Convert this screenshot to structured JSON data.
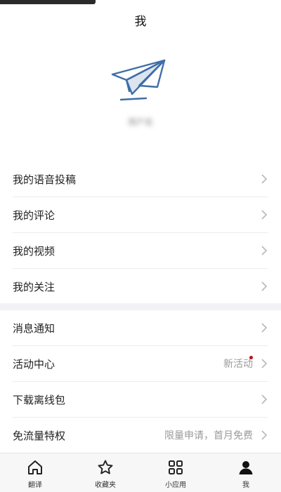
{
  "header": {
    "title": "我"
  },
  "profile": {
    "username": "用户名"
  },
  "menu_group_1": [
    {
      "label": "我的语音投稿"
    },
    {
      "label": "我的评论"
    },
    {
      "label": "我的视频"
    },
    {
      "label": "我的关注"
    }
  ],
  "menu_group_2": [
    {
      "label": "消息通知",
      "extra": ""
    },
    {
      "label": "活动中心",
      "extra": "新活动"
    },
    {
      "label": "下载离线包",
      "extra": ""
    },
    {
      "label": "免流量特权",
      "extra": "限量申请，首月免费"
    }
  ],
  "tabbar": [
    {
      "label": "翻译",
      "icon": "home-icon"
    },
    {
      "label": "收藏夹",
      "icon": "star-icon"
    },
    {
      "label": "小应用",
      "icon": "grid-icon"
    },
    {
      "label": "我",
      "icon": "person-icon"
    }
  ],
  "colors": {
    "logo_blue": "#3f6ea8",
    "badge_red": "#b5121b",
    "gap_gray": "#f2f2f4"
  }
}
